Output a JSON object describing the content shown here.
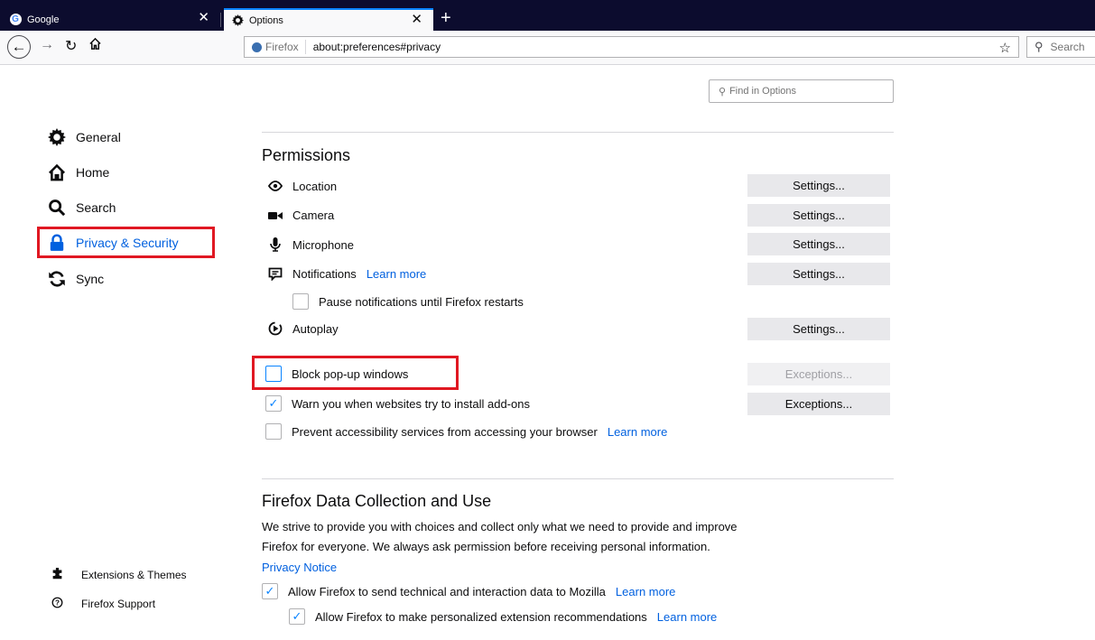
{
  "tabs": [
    {
      "title": "Google",
      "icon": "google-icon",
      "active": false
    },
    {
      "title": "Options",
      "icon": "gear-icon",
      "active": true
    }
  ],
  "nav": {
    "identity_label": "Firefox",
    "url": "about:preferences#privacy",
    "search_placeholder": "Search"
  },
  "find": {
    "placeholder": "Find in Options"
  },
  "sidebar": {
    "items": [
      {
        "label": "General",
        "icon": "gear-icon"
      },
      {
        "label": "Home",
        "icon": "home-icon"
      },
      {
        "label": "Search",
        "icon": "search-icon"
      },
      {
        "label": "Privacy & Security",
        "icon": "lock-icon",
        "selected": true
      },
      {
        "label": "Sync",
        "icon": "sync-icon"
      }
    ],
    "footer": [
      {
        "label": "Extensions & Themes",
        "icon": "puzzle-icon"
      },
      {
        "label": "Firefox Support",
        "icon": "help-icon"
      }
    ]
  },
  "permissions": {
    "heading": "Permissions",
    "rows": [
      {
        "label": "Location",
        "icon": "location-icon",
        "button": "Settings..."
      },
      {
        "label": "Camera",
        "icon": "camera-icon",
        "button": "Settings..."
      },
      {
        "label": "Microphone",
        "icon": "microphone-icon",
        "button": "Settings..."
      },
      {
        "label": "Notifications",
        "icon": "notification-icon",
        "link": "Learn more",
        "button": "Settings..."
      },
      {
        "label": "Autoplay",
        "icon": "autoplay-icon",
        "button": "Settings..."
      }
    ],
    "pause_notifications": "Pause notifications until Firefox restarts",
    "block_popups": "Block pop-up windows",
    "block_popups_button": "Exceptions...",
    "warn_addons": "Warn you when websites try to install add-ons",
    "warn_addons_button": "Exceptions...",
    "prevent_accessibility": "Prevent accessibility services from accessing your browser",
    "prevent_accessibility_link": "Learn more"
  },
  "data_collection": {
    "heading": "Firefox Data Collection and Use",
    "description_line1": "We strive to provide you with choices and collect only what we need to provide and improve",
    "description_line2": "Firefox for everyone. We always ask permission before receiving personal information.",
    "privacy_notice": "Privacy Notice",
    "allow_technical": "Allow Firefox to send technical and interaction data to Mozilla",
    "allow_technical_link": "Learn more",
    "allow_recommendations": "Allow Firefox to make personalized extension recommendations",
    "allow_recommendations_link": "Learn more"
  },
  "colors": {
    "accent": "#0060df",
    "highlight": "#e01822",
    "tabstrip": "#0c0c2e"
  }
}
